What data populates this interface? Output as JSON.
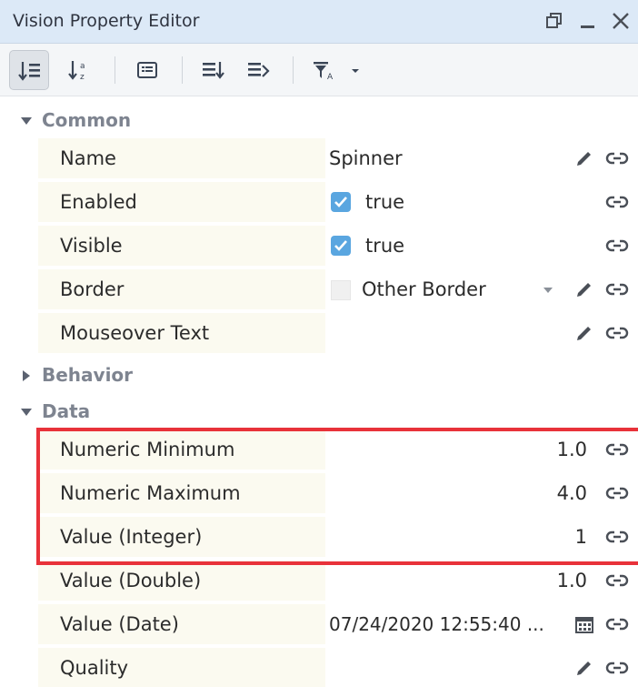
{
  "window": {
    "title": "Vision Property Editor",
    "controls": [
      "restore-icon",
      "minimize-icon",
      "close-icon"
    ]
  },
  "toolbar": {
    "buttons": [
      "sort-categorized-icon",
      "sort-alphabetical-icon",
      "details-icon",
      "expand-all-icon",
      "collapse-all-icon",
      "filter-icon",
      "dropdown-icon"
    ],
    "active": "sort-categorized-icon"
  },
  "categories": {
    "common": {
      "label": "Common",
      "expanded": true
    },
    "behavior": {
      "label": "Behavior",
      "expanded": false
    },
    "data": {
      "label": "Data",
      "expanded": true
    }
  },
  "common": {
    "name": {
      "label": "Name",
      "value": "Spinner"
    },
    "enabled": {
      "label": "Enabled",
      "value": "true",
      "checked": true
    },
    "visible": {
      "label": "Visible",
      "value": "true",
      "checked": true
    },
    "border": {
      "label": "Border",
      "value": "Other Border"
    },
    "mouseover": {
      "label": "Mouseover Text",
      "value": ""
    }
  },
  "data": {
    "numeric_min": {
      "label": "Numeric Minimum",
      "value": "1.0"
    },
    "numeric_max": {
      "label": "Numeric Maximum",
      "value": "4.0"
    },
    "value_int": {
      "label": "Value (Integer)",
      "value": "1"
    },
    "value_double": {
      "label": "Value (Double)",
      "value": "1.0"
    },
    "value_date": {
      "label": "Value (Date)",
      "value": "07/24/2020 12:55:40 ..."
    },
    "quality": {
      "label": "Quality",
      "value": ""
    }
  },
  "colors": {
    "titlebar": "#dce9f7",
    "label_background": "#fbfaf0",
    "checkbox": "#5aa6e0",
    "highlight": "#e8323a",
    "icon": "#4a4f57"
  }
}
